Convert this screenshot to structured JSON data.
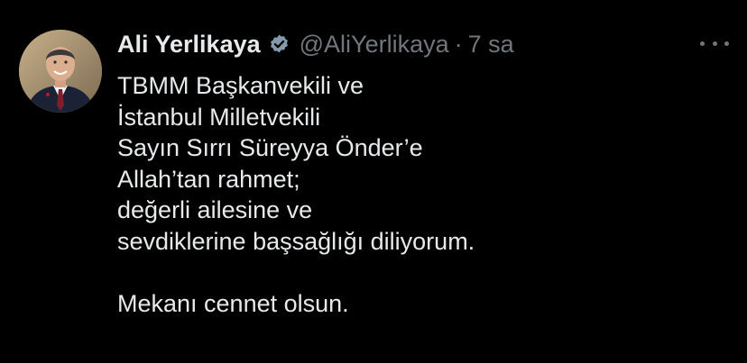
{
  "tweet": {
    "author": {
      "name": "Ali Yerlikaya",
      "handle": "@AliYerlikaya",
      "verified": true
    },
    "separator": "·",
    "time": "7 sa",
    "lines": [
      "TBMM Başkanvekili ve",
      "İstanbul Milletvekili",
      "Sayın Sırrı Süreyya Önder’e",
      "Allah’tan rahmet;",
      "değerli ailesine ve",
      "sevdiklerine başsağlığı diliyorum.",
      "",
      "Mekanı cennet olsun."
    ]
  },
  "theme": {
    "background": "#000000",
    "text": "#e7e9ea",
    "muted": "#71767b",
    "verified_badge": "#829aab"
  },
  "icons": {
    "verified": "verified-badge-icon",
    "more": "more-options-icon"
  }
}
